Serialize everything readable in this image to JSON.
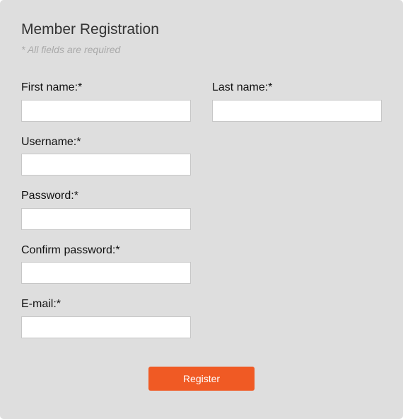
{
  "form": {
    "title": "Member Registration",
    "required_note": "* All fields are required",
    "fields": {
      "first_name": {
        "label": "First name:*",
        "value": ""
      },
      "last_name": {
        "label": "Last name:*",
        "value": ""
      },
      "username": {
        "label": "Username:*",
        "value": ""
      },
      "password": {
        "label": "Password:*",
        "value": ""
      },
      "confirm_password": {
        "label": "Confirm password:*",
        "value": ""
      },
      "email": {
        "label": "E-mail:*",
        "value": ""
      }
    },
    "submit_label": "Register"
  },
  "colors": {
    "panel_background": "#dedede",
    "button_background": "#f05a24",
    "button_text": "#ffffff",
    "note_text": "#a9a9a9"
  }
}
